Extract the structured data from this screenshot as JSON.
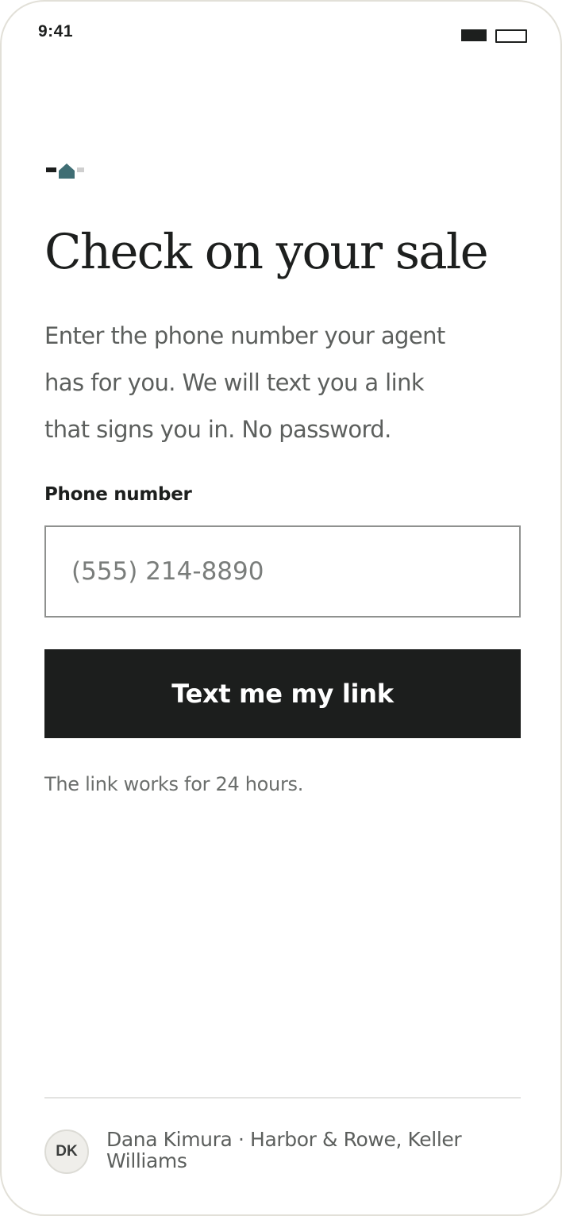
{
  "status_bar": {
    "time": "9:41",
    "icons": [
      "signal-icon",
      "battery-icon"
    ]
  },
  "brand": {
    "logo_icon": "house-logo-icon",
    "colors": {
      "accent": "#3f6e74",
      "ink": "#1c1e1d",
      "muted": "#cfcfcf"
    }
  },
  "page": {
    "title": "Check on your sale",
    "intro_lines": [
      "Enter the phone number your agent",
      "has for you. We will text you a link",
      "that signs you in. No password."
    ]
  },
  "form": {
    "phone_label": "Phone number",
    "phone_placeholder": "(555) 214-8890",
    "phone_value": "",
    "submit_label": "Text me my link",
    "note": "The link works for 24 hours."
  },
  "agent": {
    "initials": "DK",
    "line1": "Dana Kimura · Harbor & Rowe, Keller",
    "line2": "Williams"
  }
}
